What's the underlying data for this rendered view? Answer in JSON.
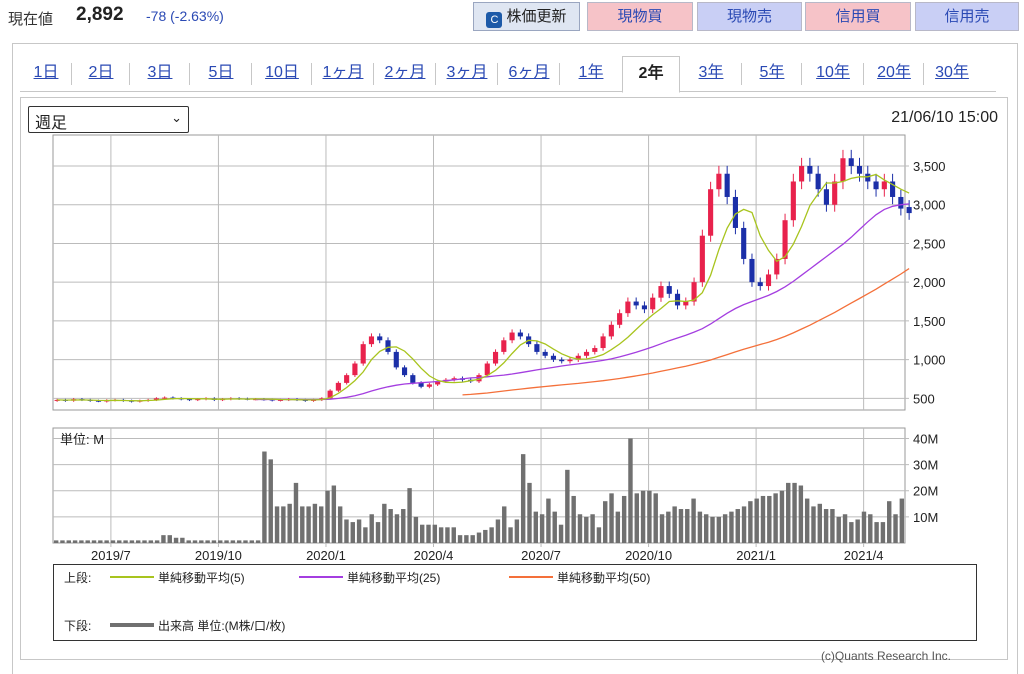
{
  "header": {
    "price_label": "現在値",
    "price": "2,892",
    "change": "-78 (-2.63%)",
    "refresh_button": "株価更新",
    "refresh_icon_glyph": "C",
    "buy_spot": "現物買",
    "sell_spot": "現物売",
    "buy_margin": "信用買",
    "sell_margin": "信用売"
  },
  "tabs": [
    {
      "label": "1日",
      "active": false
    },
    {
      "label": "2日",
      "active": false
    },
    {
      "label": "3日",
      "active": false
    },
    {
      "label": "5日",
      "active": false
    },
    {
      "label": "10日",
      "active": false
    },
    {
      "label": "1ヶ月",
      "active": false
    },
    {
      "label": "2ヶ月",
      "active": false
    },
    {
      "label": "3ヶ月",
      "active": false
    },
    {
      "label": "6ヶ月",
      "active": false
    },
    {
      "label": "1年",
      "active": false
    },
    {
      "label": "2年",
      "active": true
    },
    {
      "label": "3年",
      "active": false
    },
    {
      "label": "5年",
      "active": false
    },
    {
      "label": "10年",
      "active": false
    },
    {
      "label": "20年",
      "active": false
    },
    {
      "label": "30年",
      "active": false
    }
  ],
  "period_select": {
    "value": "週足",
    "icon": "chevron-down-icon"
  },
  "timestamp": "21/06/10 15:00",
  "volume_unit_label": "単位: M",
  "legend": {
    "upper_label": "上段:",
    "lower_label": "下段:",
    "ma5": "単純移動平均(5)",
    "ma25": "単純移動平均(25)",
    "ma50": "単純移動平均(50)",
    "volume": "出来高 単位:(M株/口/枚)"
  },
  "copyright": "(c)Quants Research Inc.",
  "colors": {
    "up": "#e8224c",
    "down": "#1b2fa8",
    "ma5": "#a8c41e",
    "ma25": "#a43ee0",
    "ma50": "#f4703a",
    "volume": "#707070"
  },
  "chart_data": {
    "type": "candlestick",
    "price_axis_ticks": [
      "3,500",
      "3,000",
      "2,500",
      "2,000",
      "1,500",
      "1,000",
      "500"
    ],
    "price_axis_values": [
      3500,
      3000,
      2500,
      2000,
      1500,
      1000,
      500
    ],
    "volume_axis_ticks": [
      "40M",
      "30M",
      "20M",
      "10M"
    ],
    "volume_axis_values": [
      40,
      30,
      20,
      10
    ],
    "x_ticks": [
      "2019/7",
      "2019/10",
      "2020/1",
      "2020/4",
      "2020/7",
      "2020/10",
      "2021/1",
      "2021/4"
    ],
    "x_tick_weeks": [
      0,
      13,
      26,
      39,
      52,
      65,
      78,
      91
    ],
    "price_ylim": [
      350,
      3900
    ],
    "volume_ylim": [
      0,
      44
    ],
    "weeks_total": 103,
    "candles_start_week": -7,
    "closes": [
      480,
      470,
      490,
      480,
      470,
      465,
      475,
      480,
      470,
      460,
      470,
      480,
      500,
      510,
      500,
      490,
      480,
      490,
      500,
      480,
      490,
      500,
      495,
      490,
      490,
      485,
      475,
      480,
      490,
      480,
      470,
      480,
      500,
      600,
      700,
      800,
      950,
      1200,
      1300,
      1250,
      1100,
      900,
      800,
      700,
      650,
      680,
      720,
      740,
      760,
      740,
      720,
      800,
      950,
      1100,
      1250,
      1350,
      1300,
      1200,
      1100,
      1050,
      1000,
      980,
      1000,
      1050,
      1100,
      1150,
      1300,
      1450,
      1600,
      1750,
      1700,
      1650,
      1800,
      1950,
      1850,
      1700,
      1750,
      2000,
      2600,
      3200,
      3400,
      3100,
      2700,
      2300,
      2000,
      1950,
      2100,
      2300,
      2800,
      3300,
      3500,
      3400,
      3200,
      3000,
      3300,
      3600,
      3500,
      3400,
      3300,
      3200,
      3300,
      3100,
      2950,
      2892
    ],
    "opens": [
      470,
      480,
      470,
      490,
      480,
      470,
      460,
      475,
      480,
      470,
      460,
      470,
      480,
      500,
      510,
      500,
      490,
      480,
      490,
      500,
      480,
      490,
      500,
      495,
      490,
      490,
      485,
      475,
      480,
      490,
      480,
      470,
      480,
      500,
      600,
      700,
      800,
      950,
      1200,
      1300,
      1250,
      1100,
      900,
      800,
      700,
      650,
      680,
      720,
      740,
      760,
      740,
      720,
      800,
      950,
      1100,
      1250,
      1350,
      1300,
      1200,
      1100,
      1050,
      1000,
      980,
      1000,
      1050,
      1100,
      1150,
      1300,
      1450,
      1600,
      1750,
      1700,
      1650,
      1800,
      1950,
      1850,
      1700,
      1750,
      2000,
      2600,
      3200,
      3400,
      3100,
      2700,
      2300,
      2000,
      1950,
      2100,
      2300,
      2800,
      3300,
      3500,
      3400,
      3200,
      3000,
      3300,
      3600,
      3500,
      3400,
      3300,
      3200,
      3300,
      3100,
      2970
    ],
    "ma5": [
      480,
      478,
      479,
      480,
      478,
      474,
      473,
      475,
      473,
      470,
      469,
      472,
      478,
      488,
      496,
      498,
      496,
      494,
      494,
      490,
      490,
      492,
      493,
      491,
      493,
      492,
      489,
      485,
      484,
      483,
      481,
      480,
      484,
      508,
      565,
      640,
      730,
      842,
      1000,
      1106,
      1160,
      1164,
      1110,
      1010,
      890,
      790,
      732,
      708,
      704,
      710,
      728,
      746,
      794,
      862,
      958,
      1080,
      1190,
      1250,
      1242,
      1202,
      1136,
      1076,
      1032,
      1006,
      1008,
      1030,
      1066,
      1128,
      1202,
      1290,
      1390,
      1490,
      1580,
      1660,
      1750,
      1760,
      1750,
      1770,
      1864,
      2090,
      2420,
      2700,
      2880,
      2940,
      2900,
      2600,
      2410,
      2270,
      2330,
      2490,
      2720,
      2990,
      3140,
      3280,
      3280,
      3300,
      3340,
      3360,
      3360,
      3390,
      3320,
      3260,
      3200,
      3150
    ],
    "ma25": [
      null,
      null,
      null,
      null,
      null,
      null,
      null,
      null,
      null,
      null,
      null,
      null,
      null,
      null,
      null,
      null,
      null,
      null,
      null,
      null,
      null,
      null,
      null,
      null,
      485,
      486,
      486,
      486,
      486,
      485,
      484,
      484,
      485,
      490,
      500,
      514,
      533,
      562,
      595,
      625,
      650,
      670,
      686,
      695,
      702,
      710,
      718,
      728,
      740,
      752,
      764,
      770,
      778,
      790,
      800,
      815,
      832,
      850,
      868,
      885,
      900,
      918,
      932,
      945,
      960,
      975,
      990,
      1010,
      1035,
      1065,
      1095,
      1130,
      1165,
      1205,
      1245,
      1280,
      1315,
      1355,
      1400,
      1460,
      1530,
      1600,
      1660,
      1710,
      1750,
      1790,
      1830,
      1880,
      1940,
      2010,
      2090,
      2170,
      2250,
      2330,
      2410,
      2490,
      2580,
      2680,
      2780,
      2870,
      2940,
      2980,
      3000,
      3010
    ],
    "ma50": [
      null,
      null,
      null,
      null,
      null,
      null,
      null,
      null,
      null,
      null,
      null,
      null,
      null,
      null,
      null,
      null,
      null,
      null,
      null,
      null,
      null,
      null,
      null,
      null,
      null,
      null,
      null,
      null,
      null,
      null,
      null,
      null,
      null,
      null,
      null,
      null,
      null,
      null,
      null,
      null,
      null,
      null,
      null,
      null,
      null,
      null,
      null,
      null,
      null,
      545,
      552,
      560,
      570,
      582,
      595,
      608,
      620,
      632,
      643,
      654,
      664,
      674,
      684,
      694,
      705,
      716,
      728,
      742,
      757,
      773,
      790,
      808,
      828,
      850,
      872,
      894,
      916,
      940,
      966,
      995,
      1030,
      1065,
      1100,
      1135,
      1165,
      1195,
      1225,
      1260,
      1300,
      1345,
      1395,
      1445,
      1500,
      1555,
      1610,
      1670,
      1730,
      1790,
      1850,
      1910,
      1975,
      2040,
      2105,
      2175
    ],
    "volumes": [
      1,
      1,
      1,
      1,
      1,
      1,
      1,
      1,
      1,
      1,
      1,
      1,
      1,
      1,
      1,
      1,
      1,
      3,
      3,
      2,
      2,
      1,
      1,
      1,
      1,
      1,
      1,
      1,
      1,
      1,
      1,
      1,
      1,
      35,
      32,
      14,
      14,
      15,
      23,
      14,
      14,
      15,
      14,
      20,
      22,
      14,
      9,
      8,
      9,
      6,
      11,
      8,
      15,
      13,
      11,
      13,
      21,
      10,
      7,
      7,
      7,
      6,
      6,
      6,
      3,
      3,
      3,
      4,
      5,
      6,
      9,
      14,
      6,
      9,
      34,
      23,
      12,
      11,
      17,
      12,
      7,
      28,
      18,
      11,
      10,
      11,
      6,
      16,
      19,
      12,
      18,
      40,
      19,
      20,
      20,
      19,
      11,
      12,
      14,
      13,
      13,
      17,
      12,
      11,
      10,
      10,
      11,
      12,
      13,
      14,
      16,
      17,
      18,
      18,
      19,
      20,
      23,
      23,
      22,
      17,
      14,
      15,
      13,
      13,
      10,
      11,
      8,
      9,
      12,
      11,
      8,
      8,
      16,
      11,
      17
    ]
  }
}
